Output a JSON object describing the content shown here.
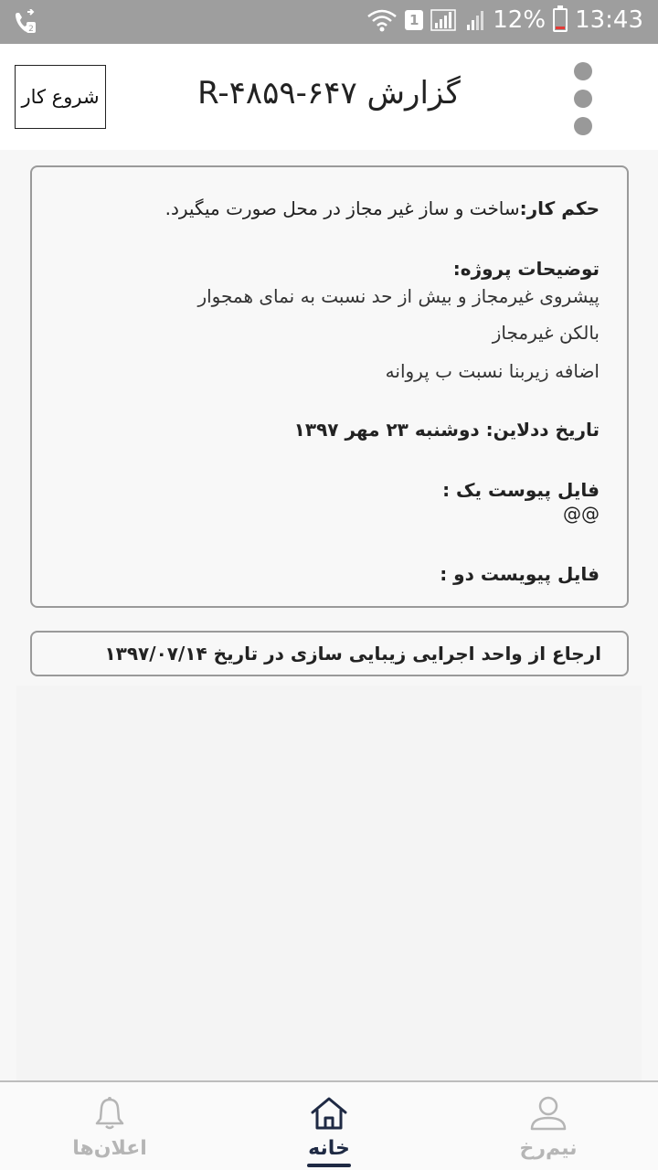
{
  "status_bar": {
    "sim_slot": "1",
    "battery": "12%",
    "time": "13:43"
  },
  "app_bar": {
    "title": "گزارش R-۴۸۵۹-۶۴۷",
    "start_button_label": "شروع کار"
  },
  "details": {
    "work_order_label": "حکم کار:",
    "work_order_value": "ساخت و ساز غیر مجاز در محل صورت میگیرد.",
    "project_desc_label": "توضیحات پروژه:",
    "project_desc_lines": [
      "پیشروی غیرمجاز و بیش از حد نسبت به نمای همجوار",
      "بالکن غیرمجاز",
      "اضافه زیربنا نسبت ب پروانه"
    ],
    "deadline_label": "تاریخ ددلاین:",
    "deadline_value": "دوشنبه ۲۳ مهر ۱۳۹۷",
    "attachment_one_label": "فایل پیوست یک :",
    "attachment_one_value": "@@",
    "attachment_two_label": "فایل پیویست دو :"
  },
  "referral": {
    "text": "ارجاع از واحد اجرایی زیبایی سازی در تاریخ ۱۳۹۷/۰۷/۱۴"
  },
  "bottom_nav": {
    "items": [
      {
        "label": "اعلان‌ها",
        "icon": "bell-icon"
      },
      {
        "label": "خانه",
        "icon": "home-icon",
        "active": true
      },
      {
        "label": "نیم‌رخ",
        "icon": "profile-icon"
      }
    ]
  },
  "colors": {
    "status_bar": "#9e9e9e",
    "nav_active": "#1f2a44",
    "nav_inactive": "#b5b5b5",
    "card_border": "#9a9a9a"
  }
}
